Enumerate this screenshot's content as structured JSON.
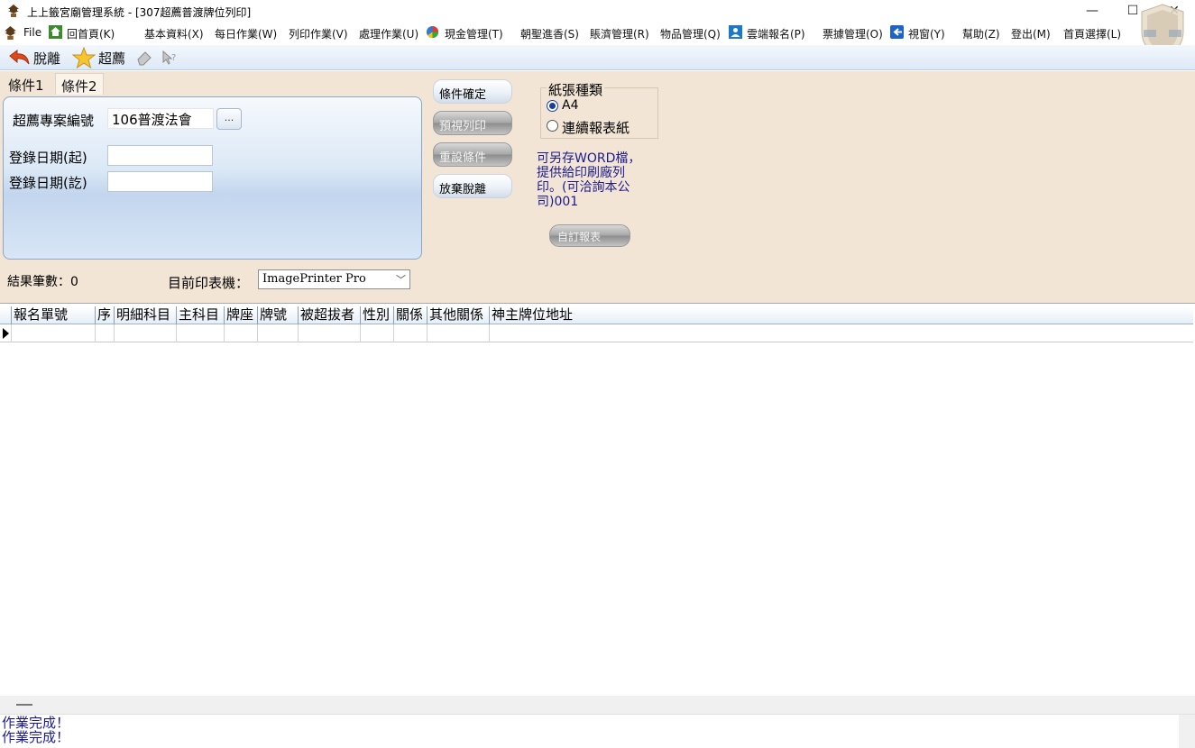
{
  "window": {
    "title": "上上籤宮廟管理系統 - [307超薦普渡牌位列印]",
    "minimize": "—",
    "maximize": "☐",
    "close": "✕"
  },
  "menu": {
    "file": "File",
    "home": "回首頁(K)",
    "basic": "基本資料(X)",
    "daily": "每日作業(W)",
    "print": "列印作業(V)",
    "process": "處理作業(U)",
    "cash": "現金管理(T)",
    "pilgrim": "朝聖進香(S)",
    "accounts": "賬濟管理(R)",
    "goods": "物品管理(Q)",
    "cloud": "雲端報名(P)",
    "tickets": "票據管理(O)",
    "window": "視窗(Y)",
    "help": "幫助(Z)",
    "logout": "登出(M)",
    "homepage": "首頁選擇(L)"
  },
  "toolbar": {
    "exit": "脫離",
    "chaojian": "超薦"
  },
  "tabs": [
    "條件1",
    "條件2"
  ],
  "form": {
    "project_label": "超薦專案編號",
    "project_value": "106普渡法會",
    "ellipsis": "...",
    "date_from_label": "登錄日期(起)",
    "date_to_label": "登錄日期(訖)",
    "date_from_value": "",
    "date_to_value": ""
  },
  "actions": {
    "confirm": "條件確定",
    "preview": "預視列印",
    "reset": "重設條件",
    "cancel": "放棄脫離",
    "custom_report": "自訂報表"
  },
  "paper": {
    "legend": "紙張種類",
    "options": [
      "A4",
      "連續報表紙"
    ],
    "selected": "A4"
  },
  "note": "可另存WORD檔，提供給印刷廠列印。(可洽詢本公司)001",
  "result": {
    "label": "結果筆數：0",
    "printer_label": "目前印表機：",
    "printer_value": "ImagePrinter Pro"
  },
  "grid": {
    "columns": [
      "報名單號",
      "序",
      "明細科目",
      "主科目",
      "牌座",
      "牌號",
      "被超拔者",
      "性別",
      "關係",
      "其他關係",
      "神主牌位地址"
    ]
  },
  "status": {
    "lines": [
      "作業完成！",
      "作業完成！"
    ]
  },
  "colors": {
    "panel_bg": "#f3e5d5",
    "note_text": "#1a1a8c",
    "accent_blue": "#1b3f9a"
  }
}
